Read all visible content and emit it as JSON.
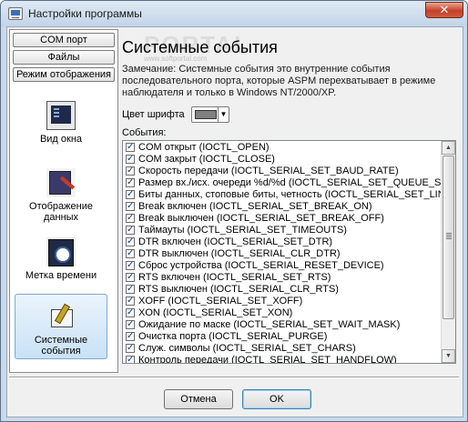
{
  "window": {
    "title": "Настройки программы",
    "close_symbol": "✕"
  },
  "watermark": {
    "text": "PORTAL",
    "url": "www.softportal.com"
  },
  "nav": {
    "tabs": [
      {
        "label": "COM порт",
        "name": "tab-com-port"
      },
      {
        "label": "Файлы",
        "name": "tab-files"
      },
      {
        "label": "Режим отображения",
        "name": "tab-display-mode"
      }
    ],
    "items": [
      {
        "label": "Вид окна",
        "icon": "window-view-icon",
        "selected": false
      },
      {
        "label": "Отображение данных",
        "icon": "data-display-icon",
        "selected": false
      },
      {
        "label": "Метка времени",
        "icon": "timestamp-icon",
        "selected": false
      },
      {
        "label": "Системные события",
        "icon": "system-events-icon",
        "selected": true
      }
    ]
  },
  "panel": {
    "heading": "Системные события",
    "note": "Замечание: Системные события это внутренние события последовательного порта, которые ASPM перехватывает в режиме наблюдателя и только в Windows NT/2000/XP.",
    "font_color_label": "Цвет шрифта",
    "font_color_value": "#808080",
    "events_label": "События:"
  },
  "events": [
    {
      "label": "COM открыт (IOCTL_OPEN)",
      "checked": true
    },
    {
      "label": "COM закрыт (IOCTL_CLOSE)",
      "checked": true
    },
    {
      "label": "Скорость передачи (IOCTL_SERIAL_SET_BAUD_RATE)",
      "checked": true
    },
    {
      "label": "Размер вх./исх. очереди %d/%d (IOCTL_SERIAL_SET_QUEUE_SIZE)",
      "checked": true
    },
    {
      "label": "Биты данных, стоповые биты, четность  (IOCTL_SERIAL_SET_LINE_CONTROL)",
      "checked": true
    },
    {
      "label": "Break включен (IOCTL_SERIAL_SET_BREAK_ON)",
      "checked": true
    },
    {
      "label": "Break выключен (IOCTL_SERIAL_SET_BREAK_OFF)",
      "checked": true
    },
    {
      "label": "Таймауты (IOCTL_SERIAL_SET_TIMEOUTS)",
      "checked": true
    },
    {
      "label": "DTR включен (IOCTL_SERIAL_SET_DTR)",
      "checked": true
    },
    {
      "label": "DTR выключен (IOCTL_SERIAL_CLR_DTR)",
      "checked": true
    },
    {
      "label": "Сброс устройства (IOCTL_SERIAL_RESET_DEVICE)",
      "checked": true
    },
    {
      "label": "RTS включен (IOCTL_SERIAL_SET_RTS)",
      "checked": true
    },
    {
      "label": "RTS выключен (IOCTL_SERIAL_CLR_RTS)",
      "checked": true
    },
    {
      "label": "XOFF (IOCTL_SERIAL_SET_XOFF)",
      "checked": true
    },
    {
      "label": "XON (IOCTL_SERIAL_SET_XON)",
      "checked": true
    },
    {
      "label": "Ожидание по маске (IOCTL_SERIAL_SET_WAIT_MASK)",
      "checked": true
    },
    {
      "label": "Очистка порта (IOCTL_SERIAL_PURGE)",
      "checked": true
    },
    {
      "label": "Служ. символы (IOCTL_SERIAL_SET_CHARS)",
      "checked": true
    },
    {
      "label": "Контроль передачи (IOCTL_SERIAL_SET_HANDFLOW)",
      "checked": true
    }
  ],
  "buttons": {
    "cancel": "Отмена",
    "ok": "OK"
  }
}
